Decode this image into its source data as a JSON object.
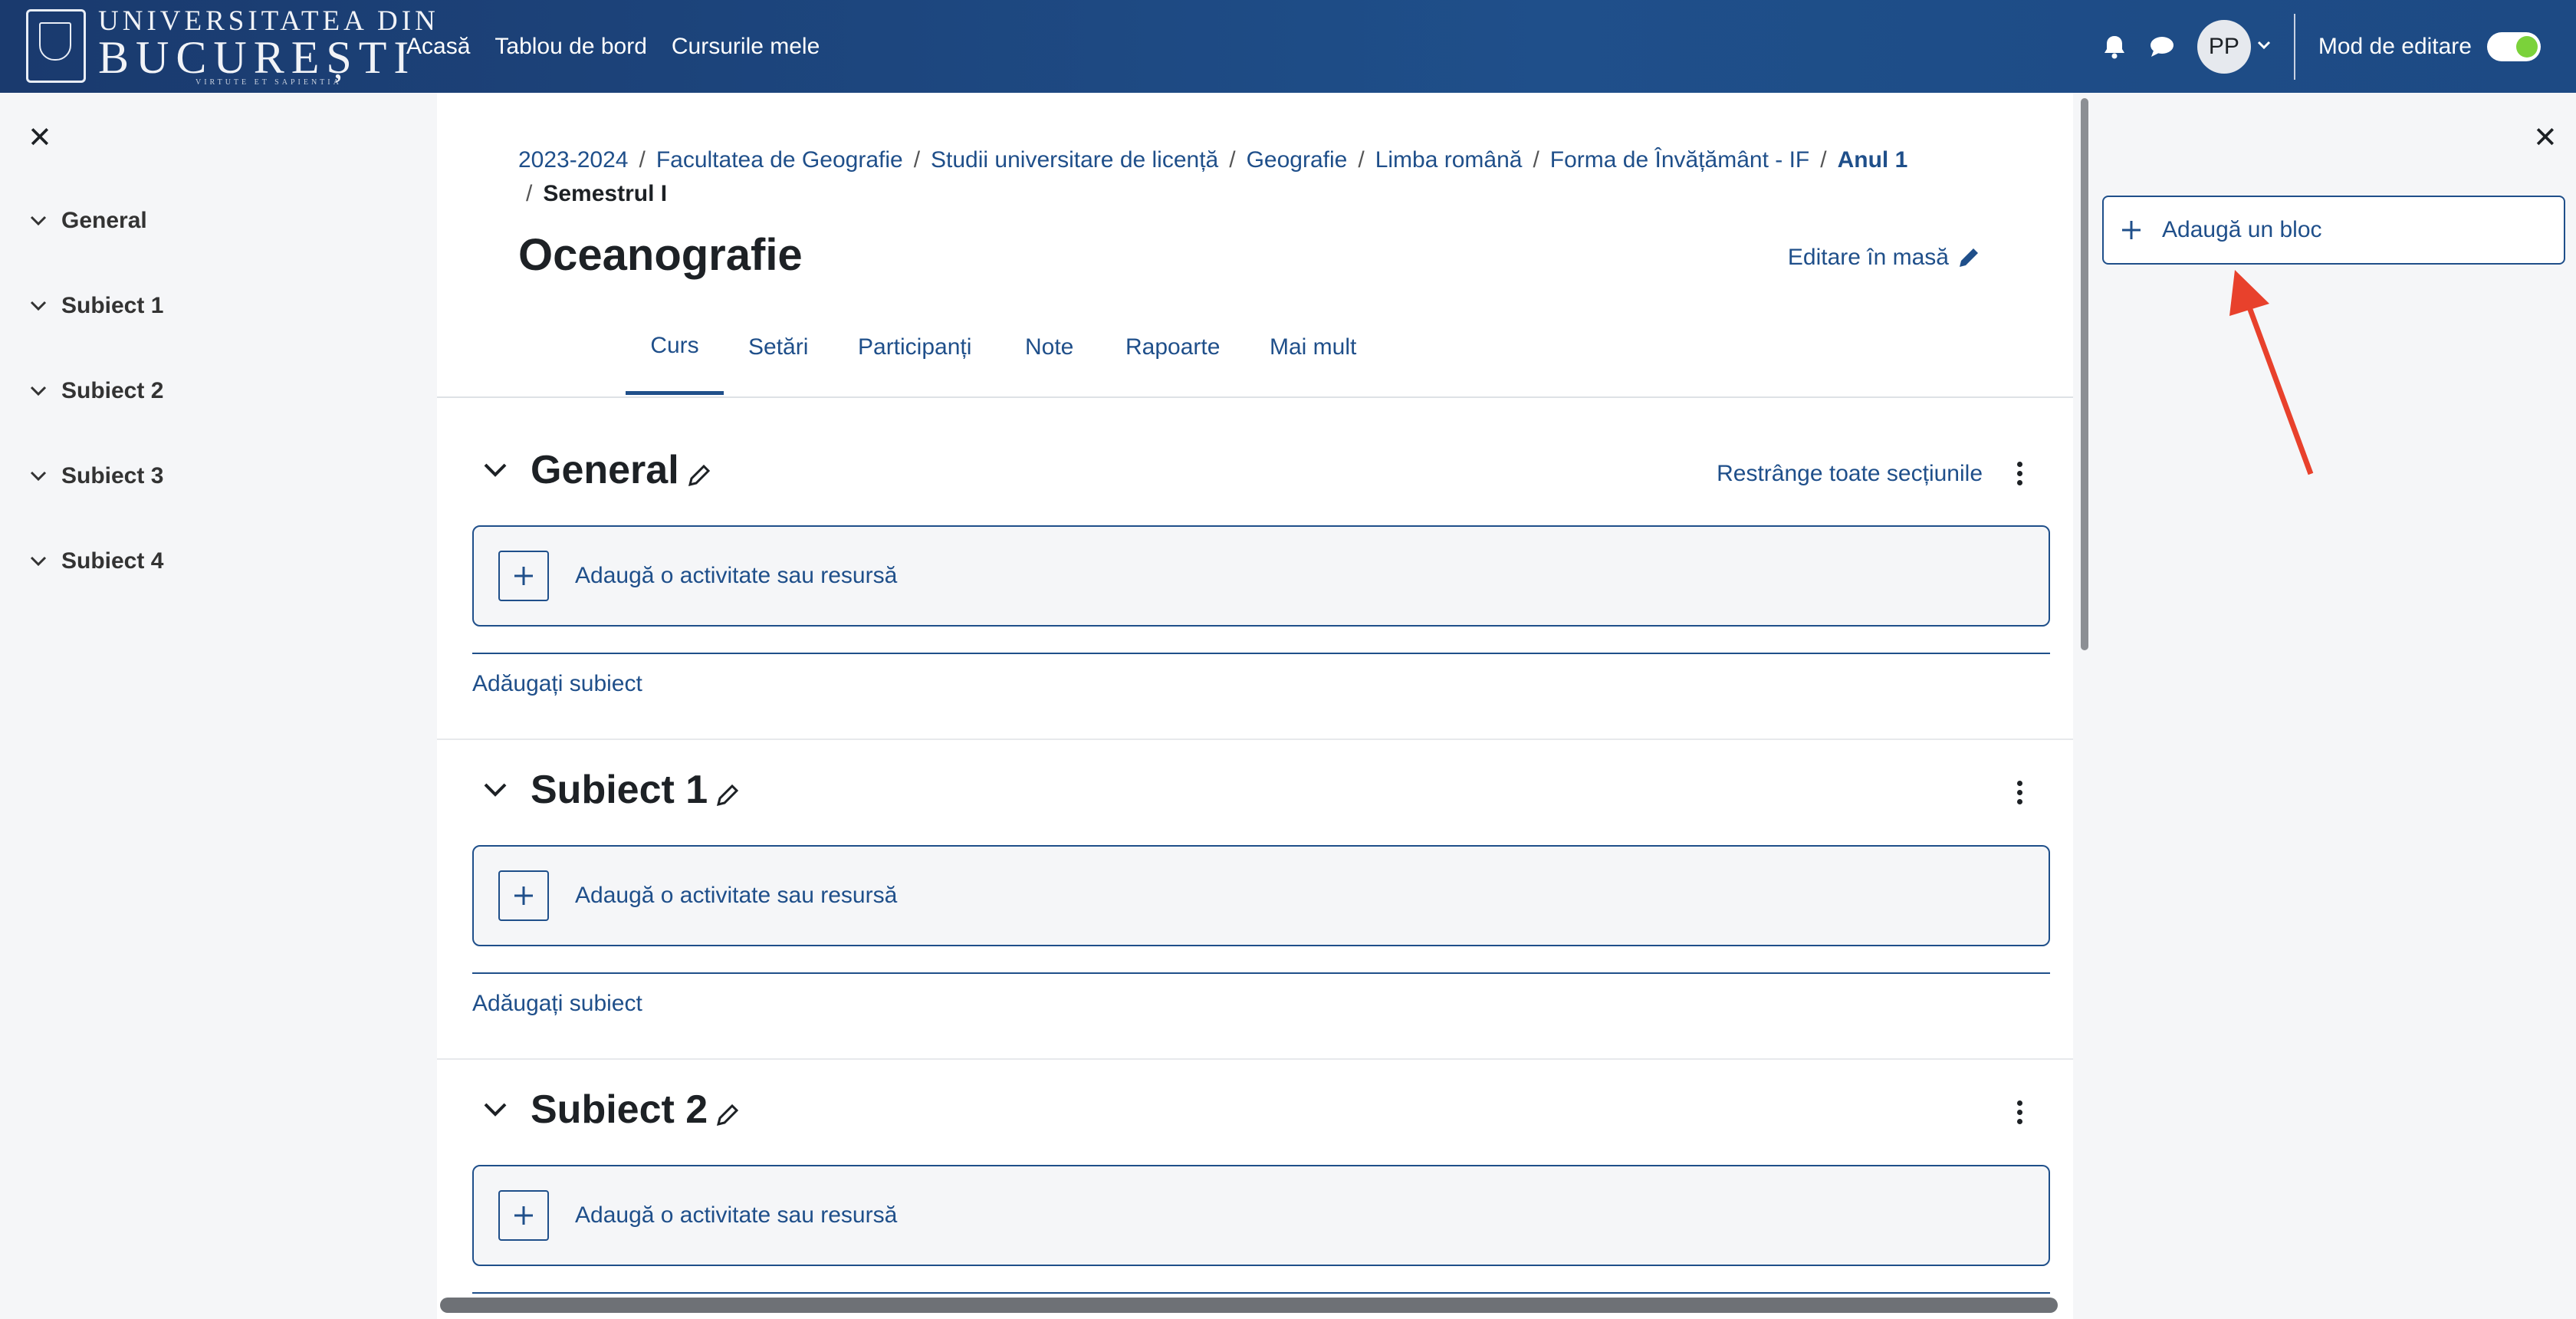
{
  "navbar": {
    "logo_line1": "UNIVERSITATEA DIN",
    "logo_line2": "BUCUREȘTI",
    "logo_line3": "VIRTUTE ET SAPIENTIA",
    "links": [
      "Acasă",
      "Tablou de bord",
      "Cursurile mele"
    ],
    "avatar_initials": "PP",
    "edit_mode_label": "Mod de editare",
    "edit_mode_on": true
  },
  "course_index": {
    "items": [
      "General",
      "Subiect 1",
      "Subiect 2",
      "Subiect 3",
      "Subiect 4"
    ]
  },
  "breadcrumb": {
    "items": [
      "2023-2024",
      "Facultatea de Geografie",
      "Studii universitare de licență",
      "Geografie",
      "Limba română",
      "Forma de Învățământ - IF",
      "Anul 1"
    ],
    "current": "Semestrul I"
  },
  "page": {
    "title": "Oceanografie",
    "bulk_edit": "Editare în masă"
  },
  "tabs": [
    "Curs",
    "Setări",
    "Participanți",
    "Note",
    "Rapoarte",
    "Mai mult"
  ],
  "sections": [
    {
      "title": "General",
      "add_activity": "Adaugă o activitate sau resursă",
      "add_subject": "Adăugați subiect"
    },
    {
      "title": "Subiect 1",
      "add_activity": "Adaugă o activitate sau resursă",
      "add_subject": "Adăugați subiect"
    },
    {
      "title": "Subiect 2",
      "add_activity": "Adaugă o activitate sau resursă"
    }
  ],
  "collapse_all": "Restrânge toate secțiunile",
  "blocks_drawer": {
    "add_block": "Adaugă un bloc"
  },
  "colors": {
    "navbar": "#1f4f8a",
    "link": "#1f4f8a",
    "annotation_arrow": "#e8412c",
    "toggle_on": "#7bd23a"
  }
}
